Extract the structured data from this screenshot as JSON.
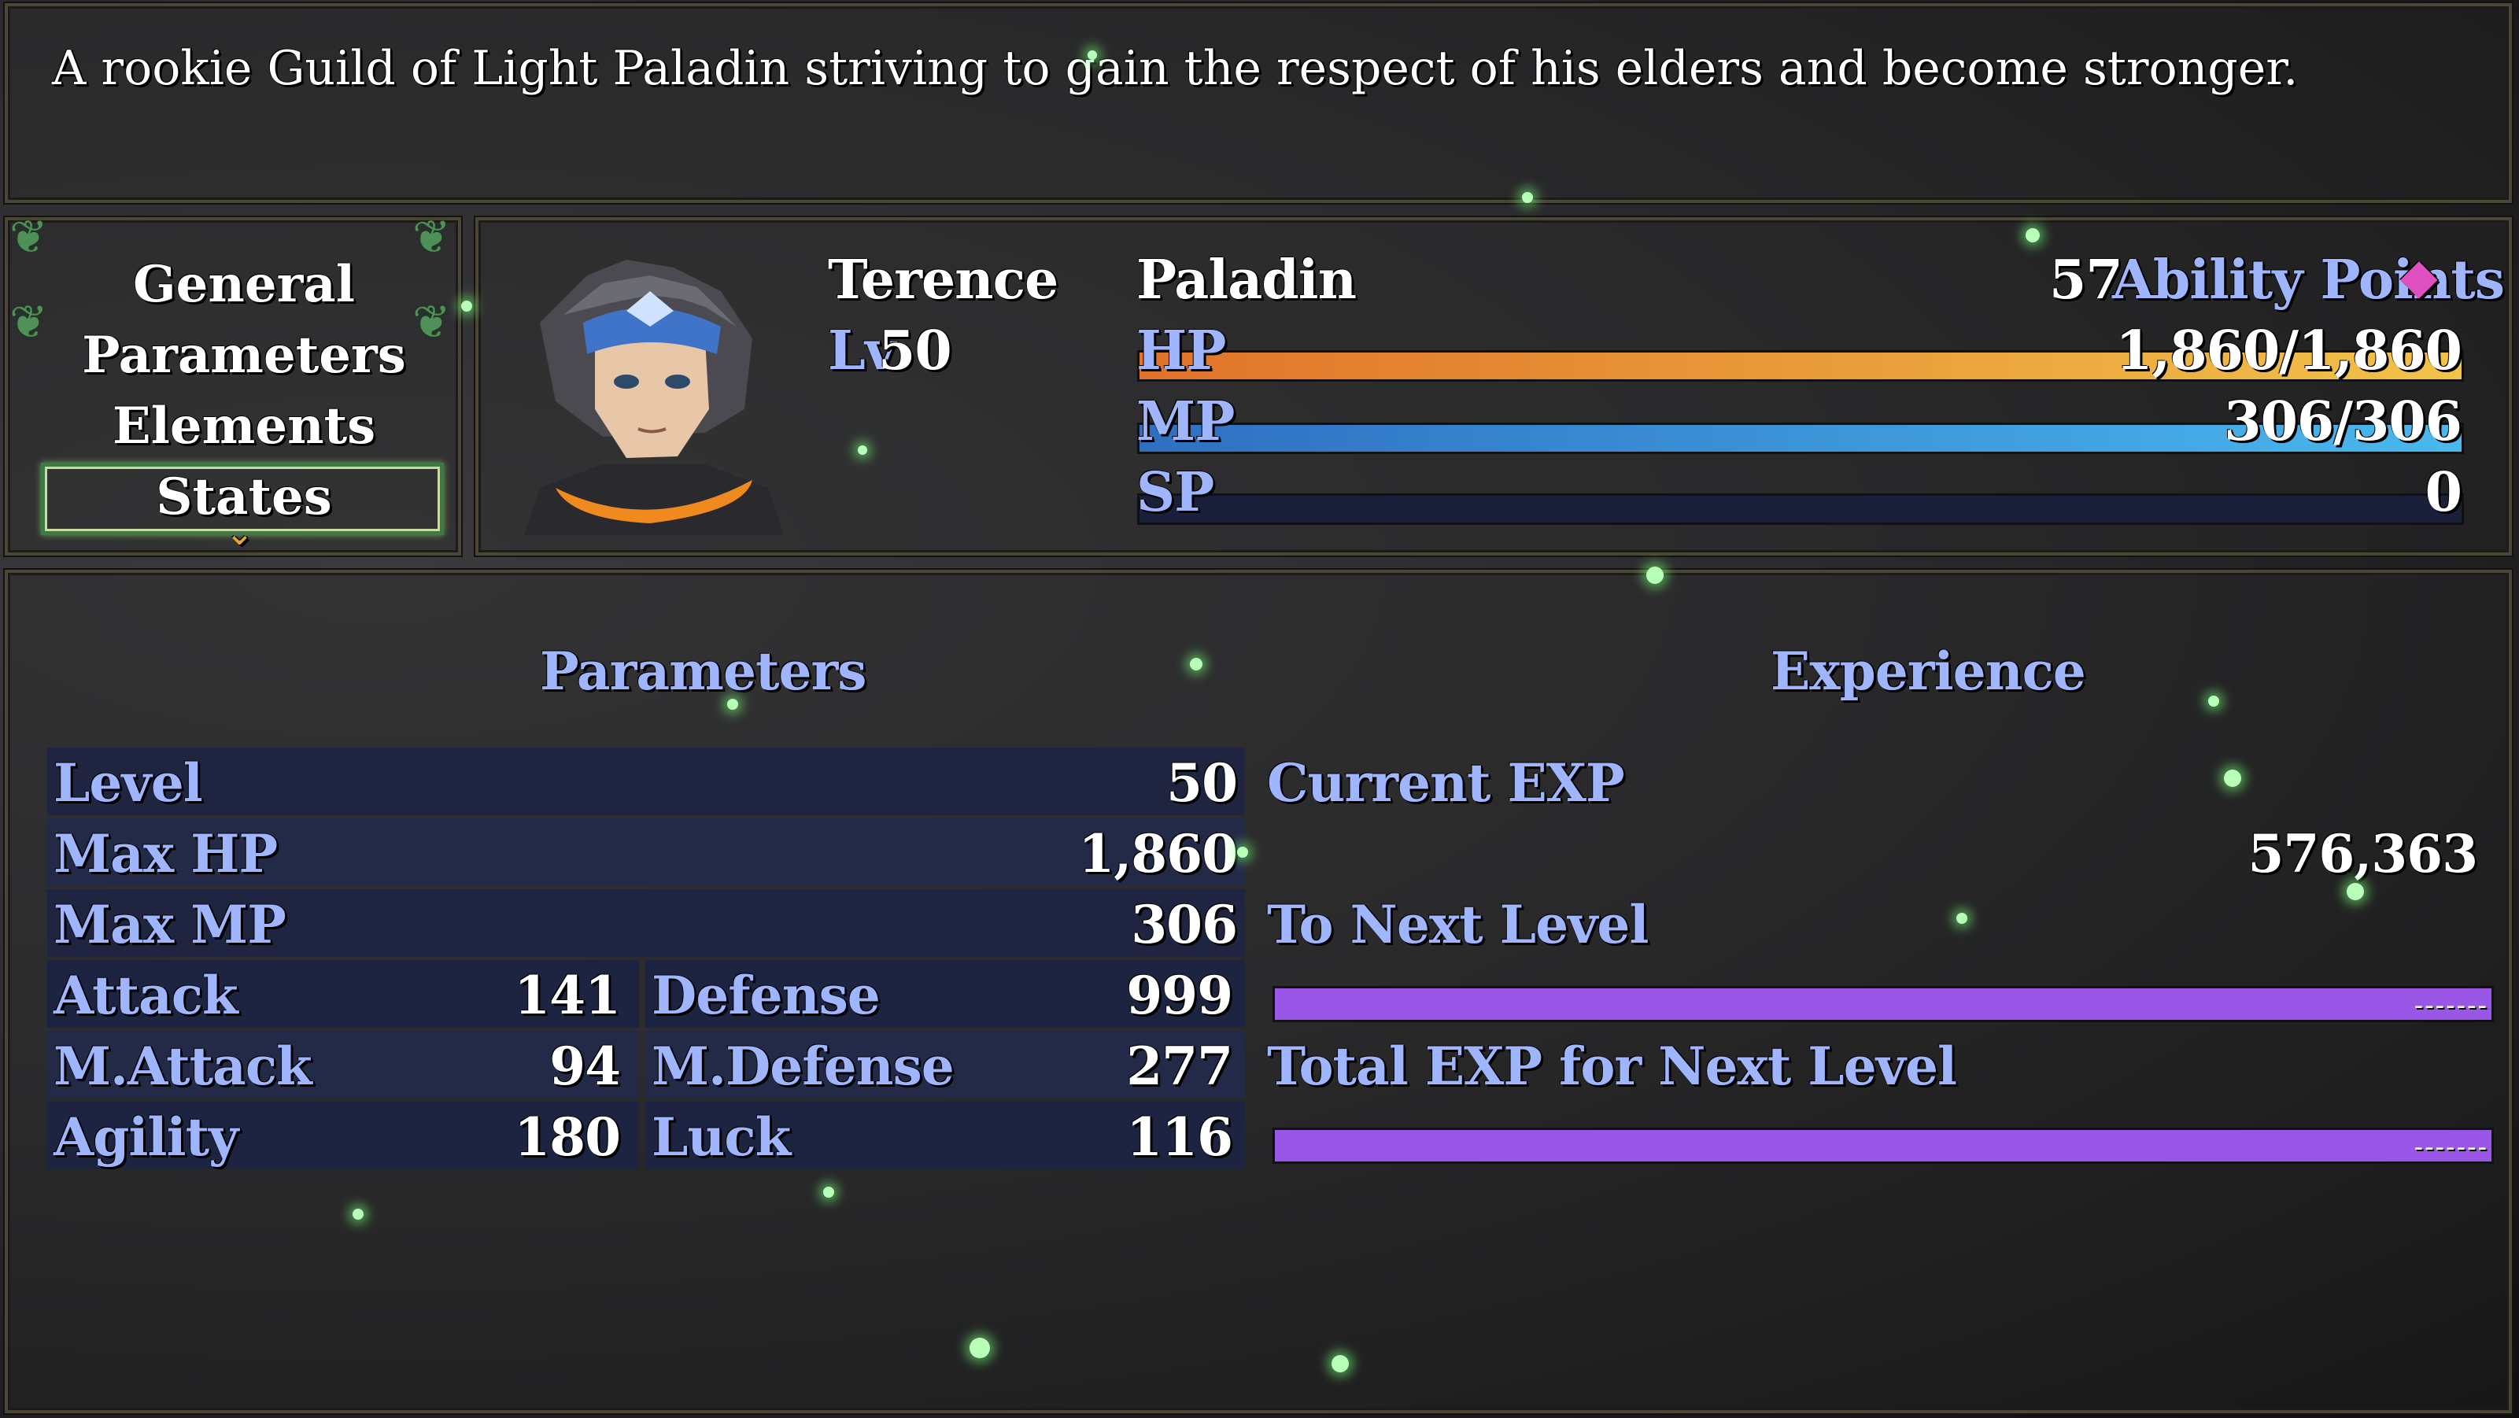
{
  "help_text": "A rookie Guild of Light Paladin striving to gain the respect of his elders and become stronger.",
  "menu": {
    "items": [
      "General",
      "Parameters",
      "Elements",
      "States"
    ],
    "selected": "General",
    "more_indicator": "⌄"
  },
  "actor": {
    "name": "Terence",
    "level_label": "Lv",
    "level": "50",
    "class": "Paladin",
    "ability_points_value": "57",
    "ability_points_label": "Ability Points",
    "ability_icon": "◆",
    "hp_label": "HP",
    "hp_text": "1,860/1,860",
    "hp_fraction": 1.0,
    "mp_label": "MP",
    "mp_text": "306/306",
    "mp_fraction": 1.0,
    "sp_label": "SP",
    "sp_text": "0",
    "sp_fraction": 0.0
  },
  "colors": {
    "hp_gradient": [
      "#e0732a",
      "#f2c24a"
    ],
    "mp_gradient": [
      "#2f6fc1",
      "#4ab8ee"
    ],
    "sp_bg": "#1a1f3a",
    "exp_bar": "#9a56e6",
    "system_blue": "#9fb6ff"
  },
  "parameters": {
    "heading": "Parameters",
    "rows": [
      {
        "label": "Level",
        "value": "50"
      },
      {
        "label": "Max HP",
        "value": "1,860"
      },
      {
        "label": "Max MP",
        "value": "306"
      }
    ],
    "pairs": [
      {
        "left_label": "Attack",
        "left_value": "141",
        "right_label": "Defense",
        "right_value": "999"
      },
      {
        "left_label": "M.Attack",
        "left_value": "94",
        "right_label": "M.Defense",
        "right_value": "277"
      },
      {
        "left_label": "Agility",
        "left_value": "180",
        "right_label": "Luck",
        "right_value": "116"
      }
    ]
  },
  "experience": {
    "heading": "Experience",
    "current_label": "Current EXP",
    "current_value": "576,363",
    "next_label": "To Next Level",
    "next_value": "-------",
    "total_label": "Total EXP for Next Level",
    "total_value": "-------"
  }
}
